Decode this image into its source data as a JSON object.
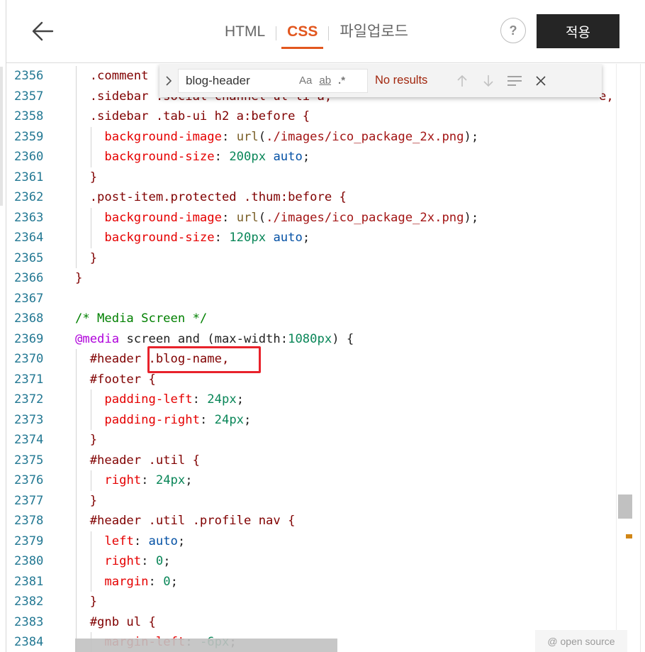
{
  "header": {
    "tabs": [
      {
        "label": "HTML",
        "active": false
      },
      {
        "label": "CSS",
        "active": true
      },
      {
        "label": "파일업로드",
        "active": false
      }
    ],
    "help_label": "?",
    "apply_label": "적용"
  },
  "find_widget": {
    "query": "blog-header",
    "match_case_label": "Aa",
    "whole_word_label": "ab",
    "regex_label": ".*",
    "status": "No results"
  },
  "editor": {
    "lines": [
      {
        "num": "2356",
        "code": "  .comment"
      },
      {
        "num": "2357",
        "code": "  .sidebar .social-channel ul li a,"
      },
      {
        "num": "2358",
        "code": "  .sidebar .tab-ui h2 a:before {"
      },
      {
        "num": "2359",
        "code": "    background-image: url(./images/ico_package_2x.png);"
      },
      {
        "num": "2360",
        "code": "    background-size: 200px auto;"
      },
      {
        "num": "2361",
        "code": "  }"
      },
      {
        "num": "2362",
        "code": "  .post-item.protected .thum:before {"
      },
      {
        "num": "2363",
        "code": "    background-image: url(./images/ico_package_2x.png);"
      },
      {
        "num": "2364",
        "code": "    background-size: 120px auto;"
      },
      {
        "num": "2365",
        "code": "  }"
      },
      {
        "num": "2366",
        "code": "}"
      },
      {
        "num": "2367",
        "code": ""
      },
      {
        "num": "2368",
        "code": "/* Media Screen */"
      },
      {
        "num": "2369",
        "code": "@media screen and (max-width:1080px) {"
      },
      {
        "num": "2370",
        "code": "  #header .blog-name,"
      },
      {
        "num": "2371",
        "code": "  #footer {"
      },
      {
        "num": "2372",
        "code": "    padding-left: 24px;"
      },
      {
        "num": "2373",
        "code": "    padding-right: 24px;"
      },
      {
        "num": "2374",
        "code": "  }"
      },
      {
        "num": "2375",
        "code": "  #header .util {"
      },
      {
        "num": "2376",
        "code": "    right: 24px;"
      },
      {
        "num": "2377",
        "code": "  }"
      },
      {
        "num": "2378",
        "code": "  #header .util .profile nav {"
      },
      {
        "num": "2379",
        "code": "    left: auto;"
      },
      {
        "num": "2380",
        "code": "    right: 0;"
      },
      {
        "num": "2381",
        "code": "    margin: 0;"
      },
      {
        "num": "2382",
        "code": "  }"
      },
      {
        "num": "2383",
        "code": "  #gnb ul {"
      },
      {
        "num": "2384",
        "code": "    margin-left: -6px;"
      }
    ]
  },
  "trailing_char": "e,",
  "open_source_label": "@ open source",
  "colors": {
    "accent": "#e2571f",
    "apply_bg": "#252525",
    "line_number": "#237893",
    "highlight_box": "#e8222b",
    "no_results": "#a1260d"
  }
}
